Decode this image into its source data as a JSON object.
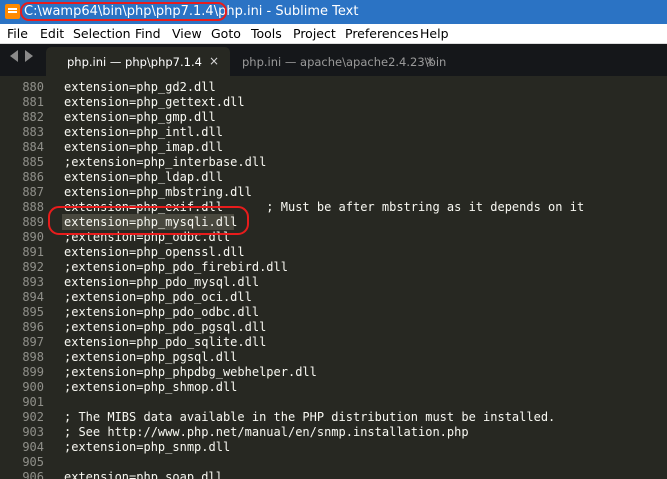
{
  "titlebar": {
    "path": "C:\\wamp64\\bin\\php\\php7.1.4\\php.ini",
    "separator": " - ",
    "app": "Sublime Text"
  },
  "menu": [
    "File",
    "Edit",
    "Selection",
    "Find",
    "View",
    "Goto",
    "Tools",
    "Project",
    "Preferences",
    "Help"
  ],
  "tabs": [
    {
      "label": "php.ini — php\\php7.1.4",
      "close": "×"
    },
    {
      "label": "php.ini — apache\\apache2.4.23\\bin",
      "close": "×"
    }
  ],
  "lines": [
    {
      "n": "880",
      "text": "extension=php_gd2.dll"
    },
    {
      "n": "881",
      "text": "extension=php_gettext.dll"
    },
    {
      "n": "882",
      "text": "extension=php_gmp.dll"
    },
    {
      "n": "883",
      "text": "extension=php_intl.dll"
    },
    {
      "n": "884",
      "text": "extension=php_imap.dll"
    },
    {
      "n": "885",
      "text": ";extension=php_interbase.dll"
    },
    {
      "n": "886",
      "text": "extension=php_ldap.dll"
    },
    {
      "n": "887",
      "text": "extension=php_mbstring.dll"
    },
    {
      "n": "888",
      "text": "extension=php_exif.dll      ; Must be after mbstring as it depends on it"
    },
    {
      "n": "889",
      "text": "extension=php_mysqli.dll"
    },
    {
      "n": "890",
      "text": ";extension=php_odbc.dll"
    },
    {
      "n": "891",
      "text": "extension=php_openssl.dll"
    },
    {
      "n": "892",
      "text": ";extension=php_pdo_firebird.dll"
    },
    {
      "n": "893",
      "text": "extension=php_pdo_mysql.dll"
    },
    {
      "n": "894",
      "text": ";extension=php_pdo_oci.dll"
    },
    {
      "n": "895",
      "text": ";extension=php_pdo_odbc.dll"
    },
    {
      "n": "896",
      "text": ";extension=php_pdo_pgsql.dll"
    },
    {
      "n": "897",
      "text": "extension=php_pdo_sqlite.dll"
    },
    {
      "n": "898",
      "text": ";extension=php_pgsql.dll"
    },
    {
      "n": "899",
      "text": ";extension=php_phpdbg_webhelper.dll"
    },
    {
      "n": "900",
      "text": ";extension=php_shmop.dll"
    },
    {
      "n": "901",
      "text": ""
    },
    {
      "n": "902",
      "text": "; The MIBS data available in the PHP distribution must be installed."
    },
    {
      "n": "903",
      "text": "; See http://www.php.net/manual/en/snmp.installation.php"
    },
    {
      "n": "904",
      "text": ";extension=php_snmp.dll"
    },
    {
      "n": "905",
      "text": ""
    },
    {
      "n": "906",
      "text": "extension=php_soap.dll"
    }
  ],
  "selected_line": "889",
  "colors": {
    "titlebar_bg": "#2b73c4",
    "editor_bg": "#272822",
    "tabbar_bg": "#15171a",
    "annotation_red": "#e81c1c",
    "selection_bg": "#49483e"
  }
}
